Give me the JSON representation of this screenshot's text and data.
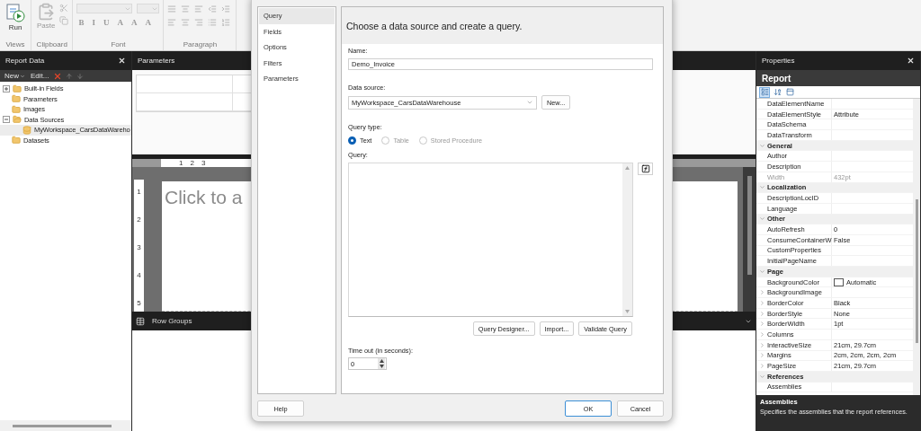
{
  "ribbon": {
    "groups": [
      {
        "kind": "views",
        "label": "Views",
        "button": {
          "label": "Run",
          "disabled": false
        }
      },
      {
        "kind": "clipboard",
        "label": "Clipboard",
        "button": {
          "label": "Paste",
          "disabled": true
        }
      },
      {
        "kind": "font",
        "label": "Font",
        "format_buttons": [
          "B",
          "I",
          "U",
          "A",
          "A",
          "A"
        ]
      },
      {
        "kind": "paragraph",
        "label": "Paragraph"
      }
    ]
  },
  "report_data": {
    "title": "Report Data",
    "toolbar": {
      "new": "New",
      "edit": "Edit..."
    },
    "tree": [
      {
        "label": "Built-in Fields",
        "expandable": true,
        "expanded": false,
        "selected": false
      },
      {
        "label": "Parameters",
        "expandable": false,
        "selected": false
      },
      {
        "label": "Images",
        "expandable": false,
        "selected": false
      },
      {
        "label": "Data Sources",
        "expandable": true,
        "expanded": true,
        "selected": false,
        "children": [
          {
            "label": "MyWorkspace_CarsDataWareho",
            "expandable": false,
            "selected": true
          }
        ]
      },
      {
        "label": "Datasets",
        "expandable": false,
        "selected": false
      }
    ]
  },
  "designer": {
    "parameters_title": "Parameters",
    "ruler": {
      "horizontal": [
        "1",
        "2",
        "3"
      ],
      "vertical": [
        "1",
        "2",
        "3",
        "4",
        "5"
      ]
    },
    "body_placeholder": "Click to a",
    "row_groups": "Row Groups"
  },
  "dialog": {
    "nav": [
      {
        "label": "Query",
        "selected": true
      },
      {
        "label": "Fields",
        "selected": false
      },
      {
        "label": "Options",
        "selected": false
      },
      {
        "label": "Filters",
        "selected": false
      },
      {
        "label": "Parameters",
        "selected": false
      }
    ],
    "heading": "Choose a data source and create a query.",
    "name": {
      "label": "Name:",
      "value": "Demo_Invoice"
    },
    "data_source": {
      "label": "Data source:",
      "value": "MyWorkspace_CarsDataWarehouse",
      "new_button": "New..."
    },
    "query_type": {
      "label": "Query type:",
      "options": [
        {
          "label": "Text",
          "selected": true,
          "disabled": false
        },
        {
          "label": "Table",
          "selected": false,
          "disabled": true
        },
        {
          "label": "Stored Procedure",
          "selected": false,
          "disabled": true
        }
      ]
    },
    "query": {
      "label": "Query:"
    },
    "query_buttons": [
      "Query Designer...",
      "Import...",
      "Validate Query"
    ],
    "timeout": {
      "label": "Time out (in seconds):",
      "value": "0"
    },
    "footer": {
      "help": "Help",
      "ok": "OK",
      "cancel": "Cancel"
    }
  },
  "properties": {
    "title": "Properties",
    "object": "Report",
    "view_buttons": [
      {
        "kind": "categorized",
        "selected": true
      },
      {
        "kind": "alphabetical",
        "selected": false
      },
      {
        "kind": "pages",
        "selected": false
      }
    ],
    "rows": [
      {
        "kind": "property",
        "name": "DataElementName",
        "expandable": false,
        "disabled": false
      },
      {
        "kind": "property",
        "name": "DataElementStyle",
        "value": "Attribute",
        "expandable": false,
        "disabled": false
      },
      {
        "kind": "property",
        "name": "DataSchema",
        "expandable": false,
        "disabled": false
      },
      {
        "kind": "property",
        "name": "DataTransform",
        "expandable": false,
        "disabled": false
      },
      {
        "kind": "category",
        "name": "General",
        "expanded": true
      },
      {
        "kind": "property",
        "name": "Author",
        "expandable": false,
        "disabled": false
      },
      {
        "kind": "property",
        "name": "Description",
        "expandable": false,
        "disabled": false
      },
      {
        "kind": "property",
        "name": "Width",
        "value": "432pt",
        "expandable": false,
        "disabled": true
      },
      {
        "kind": "category",
        "name": "Localization",
        "expanded": true
      },
      {
        "kind": "property",
        "name": "DescriptionLocID",
        "expandable": false,
        "disabled": false
      },
      {
        "kind": "property",
        "name": "Language",
        "expandable": false,
        "disabled": false
      },
      {
        "kind": "category",
        "name": "Other",
        "expanded": true
      },
      {
        "kind": "property",
        "name": "AutoRefresh",
        "value": "0",
        "expandable": false,
        "disabled": false
      },
      {
        "kind": "property",
        "name": "ConsumeContainerW",
        "value": "False",
        "expandable": false,
        "disabled": false
      },
      {
        "kind": "property",
        "name": "CustomProperties",
        "expandable": false,
        "disabled": false
      },
      {
        "kind": "property",
        "name": "InitialPageName",
        "expandable": false,
        "disabled": false
      },
      {
        "kind": "category",
        "name": "Page",
        "expanded": true
      },
      {
        "kind": "color",
        "name": "BackgroundColor",
        "value": "Automatic",
        "expandable": false,
        "disabled": false
      },
      {
        "kind": "property",
        "name": "BackgroundImage",
        "expandable": true,
        "disabled": false
      },
      {
        "kind": "property",
        "name": "BorderColor",
        "value": "Black",
        "expandable": true,
        "disabled": false
      },
      {
        "kind": "property",
        "name": "BorderStyle",
        "value": "None",
        "expandable": true,
        "disabled": false
      },
      {
        "kind": "property",
        "name": "BorderWidth",
        "value": "1pt",
        "expandable": true,
        "disabled": false
      },
      {
        "kind": "property",
        "name": "Columns",
        "expandable": true,
        "disabled": false
      },
      {
        "kind": "property",
        "name": "InteractiveSize",
        "value": "21cm, 29.7cm",
        "expandable": true,
        "disabled": false
      },
      {
        "kind": "property",
        "name": "Margins",
        "value": "2cm, 2cm, 2cm, 2cm",
        "expandable": true,
        "disabled": false
      },
      {
        "kind": "property",
        "name": "PageSize",
        "value": "21cm, 29.7cm",
        "expandable": true,
        "disabled": false
      },
      {
        "kind": "category",
        "name": "References",
        "expanded": true
      },
      {
        "kind": "property",
        "name": "Assemblies",
        "expandable": false,
        "disabled": false
      }
    ],
    "description": {
      "title": "Assemblies",
      "text": "Specifies the assemblies that the report references."
    }
  }
}
